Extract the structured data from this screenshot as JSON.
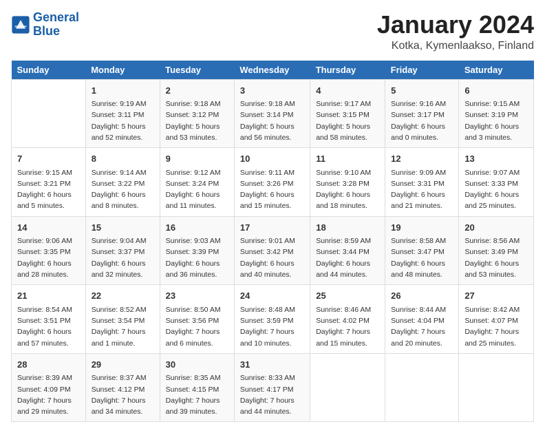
{
  "header": {
    "logo_line1": "General",
    "logo_line2": "Blue",
    "title": "January 2024",
    "subtitle": "Kotka, Kymenlaakso, Finland"
  },
  "weekdays": [
    "Sunday",
    "Monday",
    "Tuesday",
    "Wednesday",
    "Thursday",
    "Friday",
    "Saturday"
  ],
  "weeks": [
    [
      {
        "day": "",
        "info": ""
      },
      {
        "day": "1",
        "info": "Sunrise: 9:19 AM\nSunset: 3:11 PM\nDaylight: 5 hours\nand 52 minutes."
      },
      {
        "day": "2",
        "info": "Sunrise: 9:18 AM\nSunset: 3:12 PM\nDaylight: 5 hours\nand 53 minutes."
      },
      {
        "day": "3",
        "info": "Sunrise: 9:18 AM\nSunset: 3:14 PM\nDaylight: 5 hours\nand 56 minutes."
      },
      {
        "day": "4",
        "info": "Sunrise: 9:17 AM\nSunset: 3:15 PM\nDaylight: 5 hours\nand 58 minutes."
      },
      {
        "day": "5",
        "info": "Sunrise: 9:16 AM\nSunset: 3:17 PM\nDaylight: 6 hours\nand 0 minutes."
      },
      {
        "day": "6",
        "info": "Sunrise: 9:15 AM\nSunset: 3:19 PM\nDaylight: 6 hours\nand 3 minutes."
      }
    ],
    [
      {
        "day": "7",
        "info": "Sunrise: 9:15 AM\nSunset: 3:21 PM\nDaylight: 6 hours\nand 5 minutes."
      },
      {
        "day": "8",
        "info": "Sunrise: 9:14 AM\nSunset: 3:22 PM\nDaylight: 6 hours\nand 8 minutes."
      },
      {
        "day": "9",
        "info": "Sunrise: 9:12 AM\nSunset: 3:24 PM\nDaylight: 6 hours\nand 11 minutes."
      },
      {
        "day": "10",
        "info": "Sunrise: 9:11 AM\nSunset: 3:26 PM\nDaylight: 6 hours\nand 15 minutes."
      },
      {
        "day": "11",
        "info": "Sunrise: 9:10 AM\nSunset: 3:28 PM\nDaylight: 6 hours\nand 18 minutes."
      },
      {
        "day": "12",
        "info": "Sunrise: 9:09 AM\nSunset: 3:31 PM\nDaylight: 6 hours\nand 21 minutes."
      },
      {
        "day": "13",
        "info": "Sunrise: 9:07 AM\nSunset: 3:33 PM\nDaylight: 6 hours\nand 25 minutes."
      }
    ],
    [
      {
        "day": "14",
        "info": "Sunrise: 9:06 AM\nSunset: 3:35 PM\nDaylight: 6 hours\nand 28 minutes."
      },
      {
        "day": "15",
        "info": "Sunrise: 9:04 AM\nSunset: 3:37 PM\nDaylight: 6 hours\nand 32 minutes."
      },
      {
        "day": "16",
        "info": "Sunrise: 9:03 AM\nSunset: 3:39 PM\nDaylight: 6 hours\nand 36 minutes."
      },
      {
        "day": "17",
        "info": "Sunrise: 9:01 AM\nSunset: 3:42 PM\nDaylight: 6 hours\nand 40 minutes."
      },
      {
        "day": "18",
        "info": "Sunrise: 8:59 AM\nSunset: 3:44 PM\nDaylight: 6 hours\nand 44 minutes."
      },
      {
        "day": "19",
        "info": "Sunrise: 8:58 AM\nSunset: 3:47 PM\nDaylight: 6 hours\nand 48 minutes."
      },
      {
        "day": "20",
        "info": "Sunrise: 8:56 AM\nSunset: 3:49 PM\nDaylight: 6 hours\nand 53 minutes."
      }
    ],
    [
      {
        "day": "21",
        "info": "Sunrise: 8:54 AM\nSunset: 3:51 PM\nDaylight: 6 hours\nand 57 minutes."
      },
      {
        "day": "22",
        "info": "Sunrise: 8:52 AM\nSunset: 3:54 PM\nDaylight: 7 hours\nand 1 minute."
      },
      {
        "day": "23",
        "info": "Sunrise: 8:50 AM\nSunset: 3:56 PM\nDaylight: 7 hours\nand 6 minutes."
      },
      {
        "day": "24",
        "info": "Sunrise: 8:48 AM\nSunset: 3:59 PM\nDaylight: 7 hours\nand 10 minutes."
      },
      {
        "day": "25",
        "info": "Sunrise: 8:46 AM\nSunset: 4:02 PM\nDaylight: 7 hours\nand 15 minutes."
      },
      {
        "day": "26",
        "info": "Sunrise: 8:44 AM\nSunset: 4:04 PM\nDaylight: 7 hours\nand 20 minutes."
      },
      {
        "day": "27",
        "info": "Sunrise: 8:42 AM\nSunset: 4:07 PM\nDaylight: 7 hours\nand 25 minutes."
      }
    ],
    [
      {
        "day": "28",
        "info": "Sunrise: 8:39 AM\nSunset: 4:09 PM\nDaylight: 7 hours\nand 29 minutes."
      },
      {
        "day": "29",
        "info": "Sunrise: 8:37 AM\nSunset: 4:12 PM\nDaylight: 7 hours\nand 34 minutes."
      },
      {
        "day": "30",
        "info": "Sunrise: 8:35 AM\nSunset: 4:15 PM\nDaylight: 7 hours\nand 39 minutes."
      },
      {
        "day": "31",
        "info": "Sunrise: 8:33 AM\nSunset: 4:17 PM\nDaylight: 7 hours\nand 44 minutes."
      },
      {
        "day": "",
        "info": ""
      },
      {
        "day": "",
        "info": ""
      },
      {
        "day": "",
        "info": ""
      }
    ]
  ]
}
